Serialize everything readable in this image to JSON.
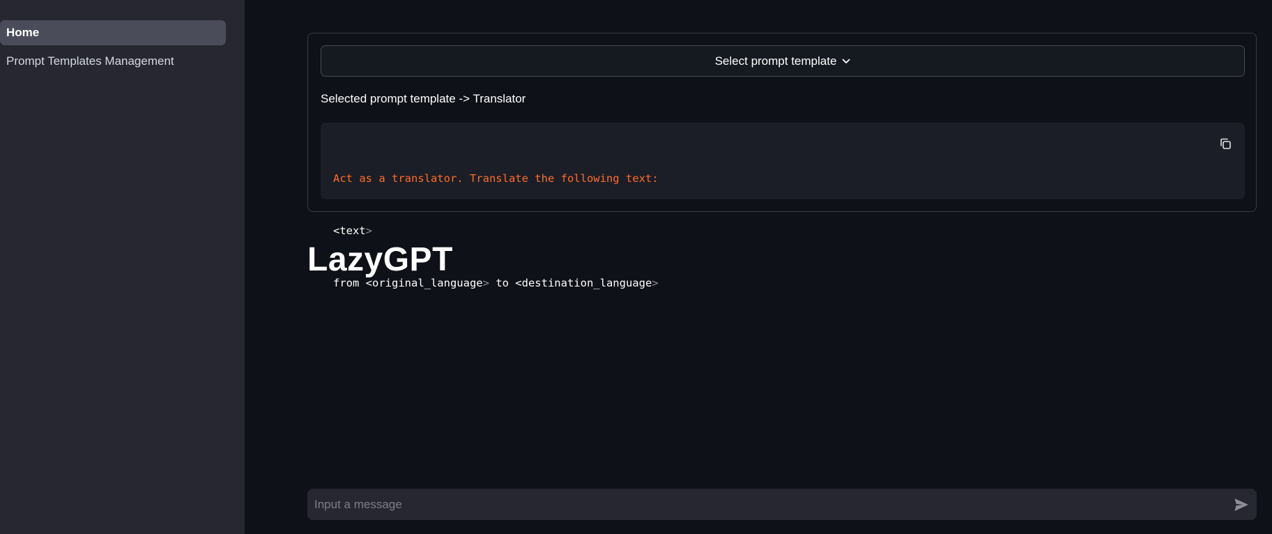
{
  "sidebar": {
    "items": [
      {
        "label": "Home",
        "active": true
      },
      {
        "label": "Prompt Templates Management",
        "active": false
      }
    ]
  },
  "template": {
    "select_label": "Select prompt template",
    "selected_text": "Selected prompt template -> Translator",
    "code": {
      "line1": "Act as a translator. Translate the following text:",
      "line2_open": "<text",
      "line2_close": ">",
      "line3_a": "from <original_language",
      "line3_b": ">",
      "line3_c": " to <destination_language",
      "line3_d": ">"
    }
  },
  "main": {
    "title": "LazyGPT"
  },
  "chat": {
    "placeholder": "Input a message"
  },
  "icons": {
    "chevron": "chevron-down-icon",
    "copy": "copy-icon",
    "send": "send-icon"
  },
  "colors": {
    "background": "#0e1117",
    "sidebar": "#262730",
    "active_item": "#4a4c59",
    "code_highlight": "#ff6b2b"
  }
}
